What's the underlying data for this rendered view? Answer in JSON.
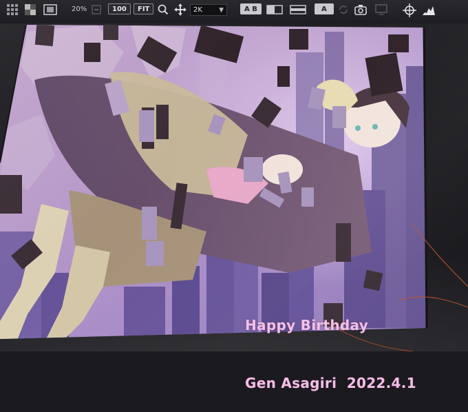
{
  "toolbar": {
    "zoom_value": "20%",
    "zoom_100_label": "100",
    "fit_label": "FIT",
    "resolution": "2K",
    "ab_compare_label": "A B",
    "overlay_label": "A"
  },
  "artwork": {
    "greeting_line1": "Happy Birthday",
    "greeting_line2": "Gen Asagiri  2022.4.1"
  },
  "colors": {
    "greeting_text": "#f4bfe4",
    "toolbar_bg": "#242328",
    "canvas_sky": "#b497c8"
  }
}
